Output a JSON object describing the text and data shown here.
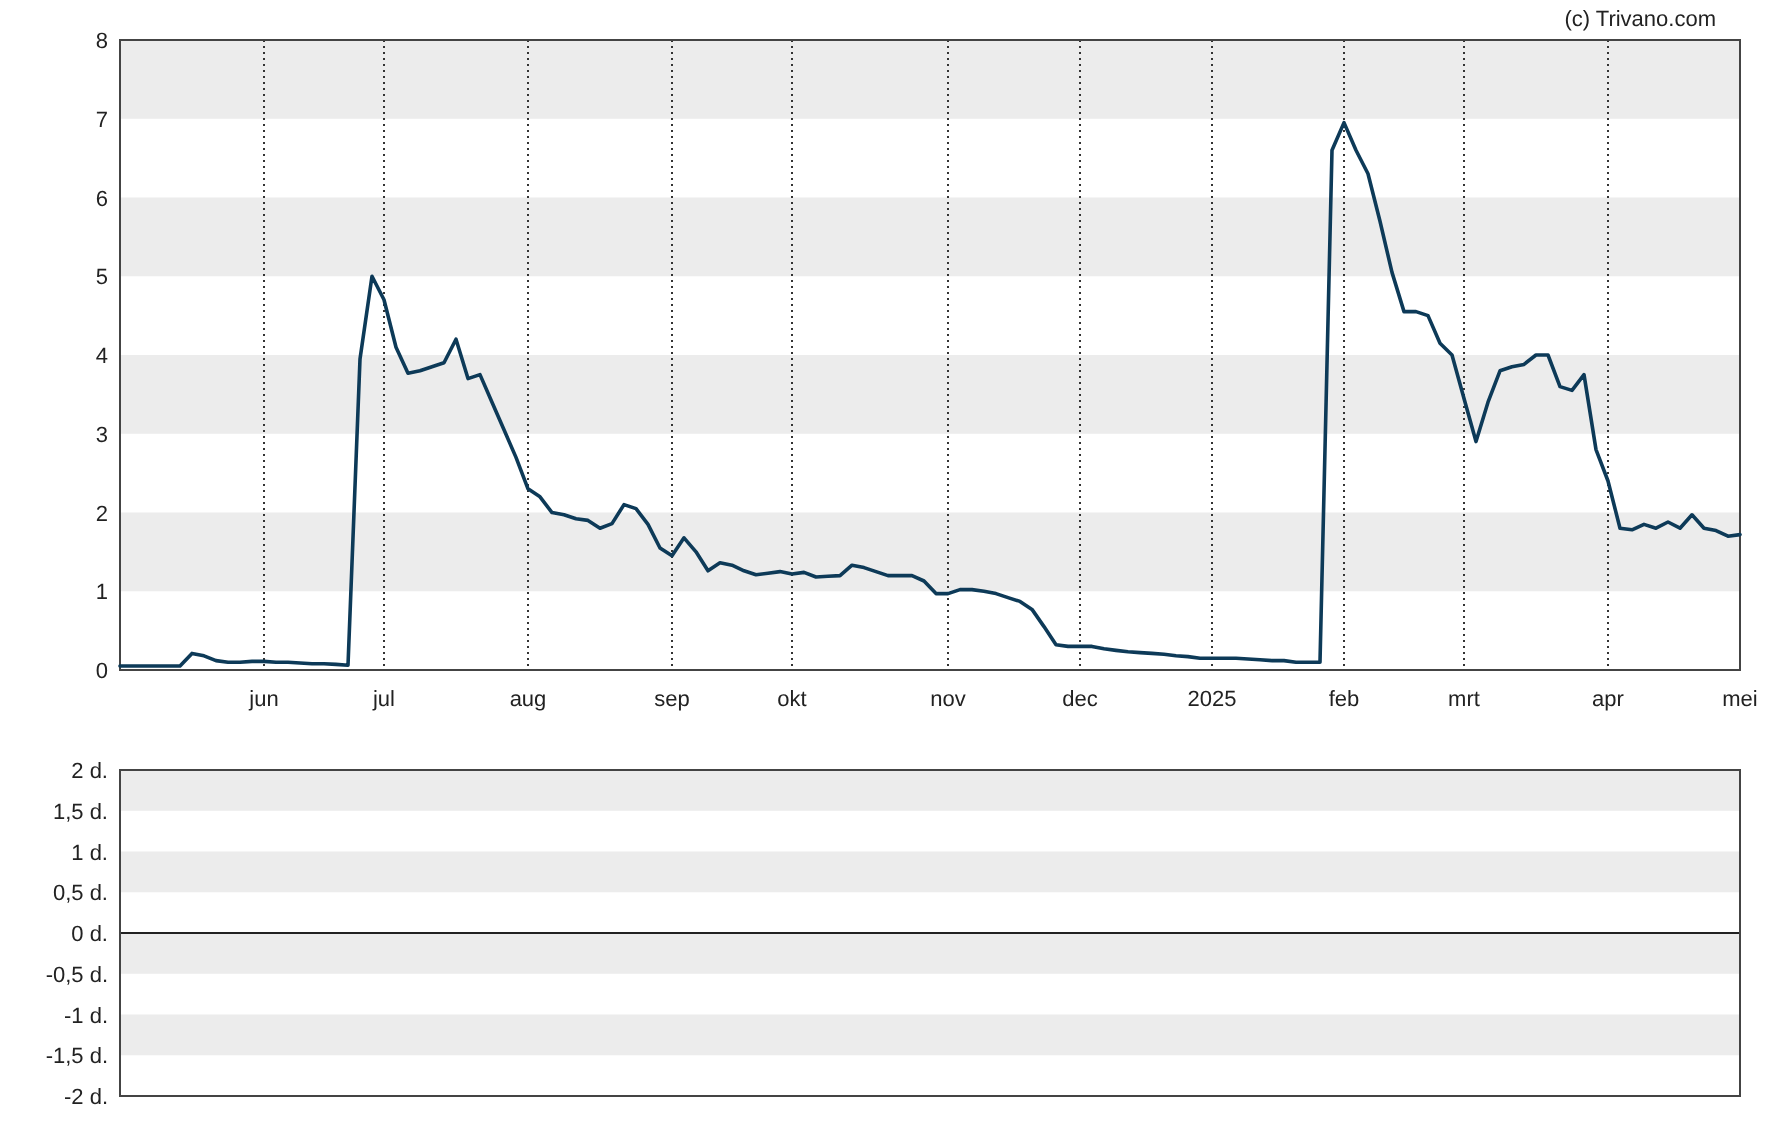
{
  "copyright": "(c) Trivano.com",
  "price_chart": {
    "chart_data": {
      "type": "line",
      "ylim": [
        0,
        8
      ],
      "yticks": [
        0,
        1,
        2,
        3,
        4,
        5,
        6,
        7,
        8
      ],
      "categories": [
        null,
        null,
        null,
        null,
        null,
        null,
        null,
        null,
        null,
        null,
        null,
        null,
        "jun",
        null,
        null,
        null,
        null,
        null,
        null,
        null,
        null,
        null,
        "jul",
        null,
        null,
        null,
        null,
        null,
        null,
        null,
        null,
        null,
        null,
        null,
        "aug",
        null,
        null,
        null,
        null,
        null,
        null,
        null,
        null,
        null,
        null,
        null,
        "sep",
        null,
        null,
        null,
        null,
        null,
        null,
        null,
        null,
        null,
        "okt",
        null,
        null,
        null,
        null,
        null,
        null,
        null,
        null,
        null,
        null,
        null,
        null,
        "nov",
        null,
        null,
        null,
        null,
        null,
        null,
        null,
        null,
        null,
        null,
        "dec",
        null,
        null,
        null,
        null,
        null,
        null,
        null,
        null,
        null,
        null,
        "2025",
        null,
        null,
        null,
        null,
        null,
        null,
        null,
        null,
        null,
        null,
        "feb",
        null,
        null,
        null,
        null,
        null,
        null,
        null,
        null,
        null,
        "mrt",
        null,
        null,
        null,
        null,
        null,
        null,
        null,
        null,
        null,
        null,
        null,
        "apr",
        null,
        null,
        null,
        null,
        null,
        null,
        null,
        null,
        null,
        null,
        "mei"
      ],
      "series": [
        {
          "color": "#0d3a58",
          "values": [
            0.05,
            0.05,
            0.05,
            0.05,
            0.05,
            0.05,
            0.21,
            0.18,
            0.12,
            0.1,
            0.1,
            0.11,
            0.11,
            0.1,
            0.1,
            0.09,
            0.08,
            0.08,
            0.07,
            0.06,
            3.95,
            5.0,
            4.7,
            4.1,
            3.77,
            3.8,
            3.85,
            3.9,
            4.2,
            3.7,
            3.75,
            3.4,
            3.05,
            2.7,
            2.3,
            2.2,
            2.0,
            1.97,
            1.92,
            1.9,
            1.8,
            1.86,
            2.1,
            2.05,
            1.85,
            1.55,
            1.45,
            1.68,
            1.5,
            1.26,
            1.36,
            1.33,
            1.26,
            1.21,
            1.23,
            1.25,
            1.22,
            1.24,
            1.18,
            1.19,
            1.2,
            1.33,
            1.3,
            1.25,
            1.2,
            1.2,
            1.2,
            1.13,
            0.97,
            0.97,
            1.02,
            1.02,
            1.0,
            0.97,
            0.92,
            0.87,
            0.77,
            0.55,
            0.32,
            0.3,
            0.3,
            0.3,
            0.27,
            0.25,
            0.23,
            0.22,
            0.21,
            0.2,
            0.18,
            0.17,
            0.15,
            0.15,
            0.15,
            0.15,
            0.14,
            0.13,
            0.12,
            0.12,
            0.1,
            0.1,
            0.1,
            6.6,
            6.95,
            6.6,
            6.3,
            5.7,
            5.05,
            4.55,
            4.55,
            4.5,
            4.15,
            4.0,
            3.45,
            2.9,
            3.4,
            3.8,
            3.85,
            3.88,
            4.0,
            4.0,
            3.6,
            3.55,
            3.75,
            2.8,
            2.4,
            1.8,
            1.78,
            1.85,
            1.8,
            1.88,
            1.8,
            1.97,
            1.8,
            1.77,
            1.7,
            1.72
          ]
        }
      ]
    }
  },
  "lower_chart": {
    "chart_data": {
      "type": "line",
      "categories": [
        null,
        null
      ],
      "ylim": [
        -2,
        2
      ],
      "yticks": [
        {
          "value": 2,
          "label": "2 d."
        },
        {
          "value": 1.5,
          "label": "1,5 d."
        },
        {
          "value": 1,
          "label": "1 d."
        },
        {
          "value": 0.5,
          "label": "0,5 d."
        },
        {
          "value": 0,
          "label": "0 d."
        },
        {
          "value": -0.5,
          "label": "-0,5 d."
        },
        {
          "value": -1,
          "label": "-1 d."
        },
        {
          "value": -1.5,
          "label": "-1,5 d."
        },
        {
          "value": -2,
          "label": "-2 d."
        }
      ]
    }
  }
}
